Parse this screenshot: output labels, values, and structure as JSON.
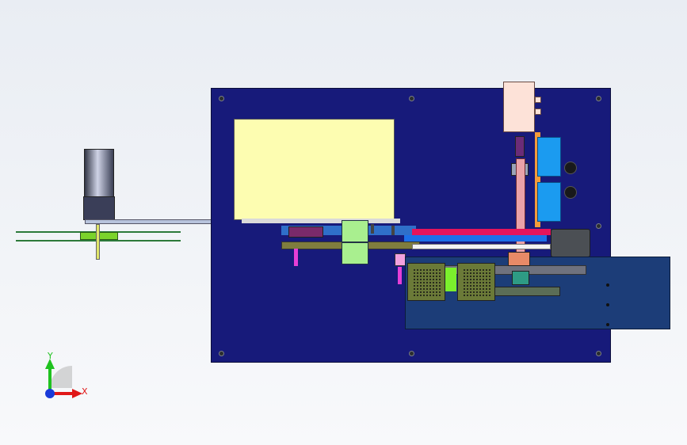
{
  "viewer": {
    "triad": {
      "x_label": "X",
      "y_label": "Y",
      "x_color": "#e01818",
      "y_color": "#1fc21f",
      "z_color": "#1a3bd9"
    }
  },
  "model": {
    "baseplate_color": "#171a7a",
    "panel_color": "#fdfdb1",
    "accent_colors": [
      "#f49b39",
      "#1b9bf0",
      "#e5145b",
      "#a9ef8f",
      "#e63fd6",
      "#7bf02d"
    ]
  }
}
